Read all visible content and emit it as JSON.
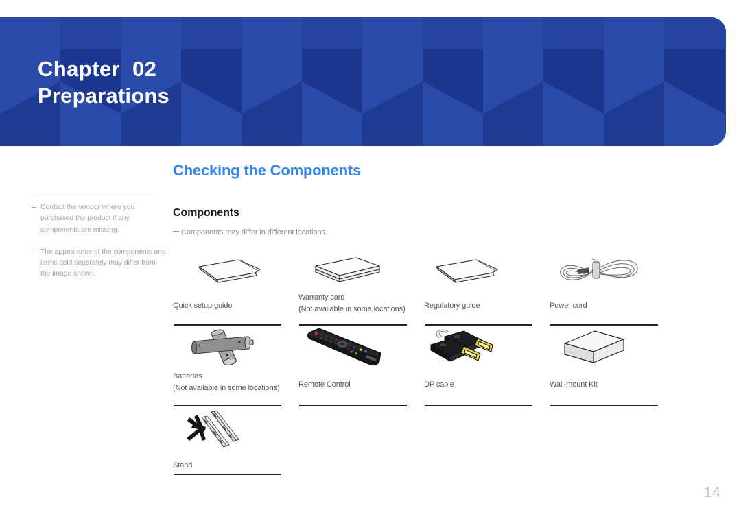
{
  "banner": {
    "chapter_line1": "Chapter  02",
    "chapter_line2": "Preparations",
    "background_color": "#21409a"
  },
  "section": {
    "title": "Checking the Components",
    "title_color": "#2f87f0",
    "subtitle": "Components",
    "inline_note": "Components may differ in different locations."
  },
  "sidebar": {
    "notes": [
      "Contact the vendor where you purchased the product if any components are missing.",
      "The appearance of the components and items sold separately may differ from the image shown."
    ]
  },
  "components": {
    "rows": [
      [
        {
          "icon": "quick-setup-guide-icon",
          "label": "Quick setup guide",
          "sublabel": ""
        },
        {
          "icon": "warranty-card-icon",
          "label": "Warranty card",
          "sublabel": "(Not available in some locations)"
        },
        {
          "icon": "regulatory-guide-icon",
          "label": "Regulatory guide",
          "sublabel": ""
        },
        {
          "icon": "power-cord-icon",
          "label": "Power cord",
          "sublabel": ""
        }
      ],
      [
        {
          "icon": "batteries-icon",
          "label": "Batteries",
          "sublabel": "(Not available in some locations)"
        },
        {
          "icon": "remote-control-icon",
          "label": "Remote Control",
          "sublabel": ""
        },
        {
          "icon": "dp-cable-icon",
          "label": "DP cable",
          "sublabel": ""
        },
        {
          "icon": "wall-mount-kit-icon",
          "label": "Wall-mount Kit",
          "sublabel": ""
        }
      ],
      [
        {
          "icon": "stand-icon",
          "label": "Stand",
          "sublabel": ""
        }
      ]
    ]
  },
  "footer": {
    "page_number": "14"
  }
}
